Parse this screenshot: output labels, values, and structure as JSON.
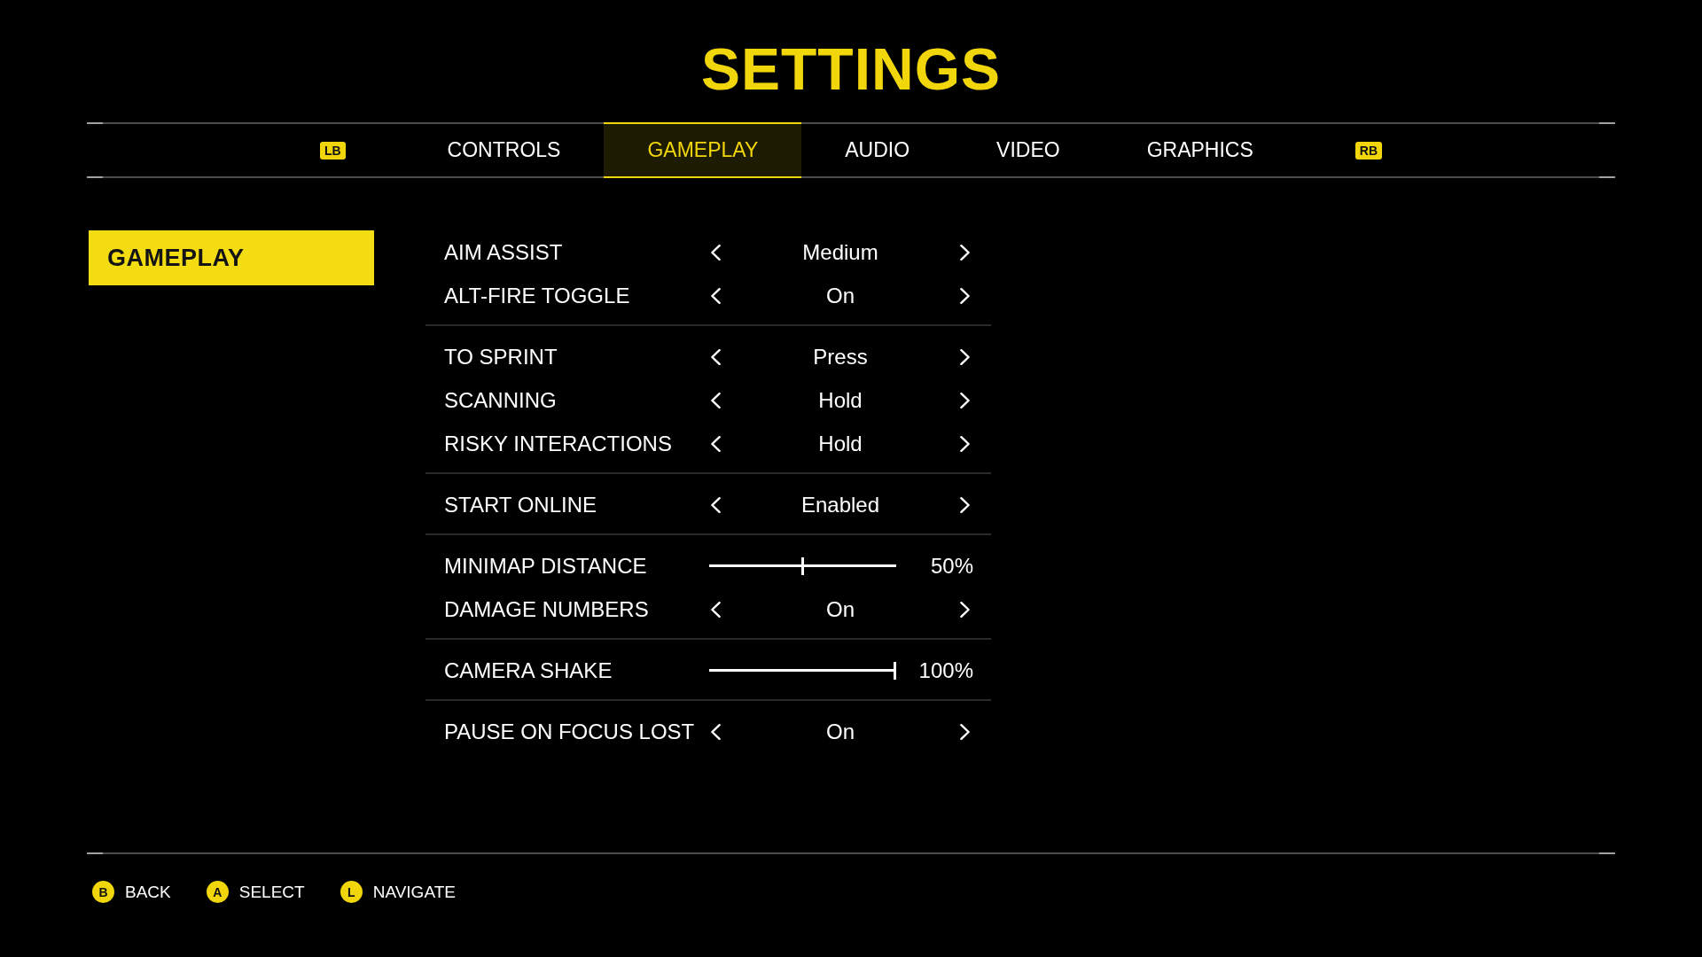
{
  "title": "SETTINGS",
  "tab_bar": {
    "prev_key": "LB",
    "next_key": "RB",
    "tabs": [
      {
        "label": "CONTROLS",
        "selected": false
      },
      {
        "label": "GAMEPLAY",
        "selected": true
      },
      {
        "label": "AUDIO",
        "selected": false
      },
      {
        "label": "VIDEO",
        "selected": false
      },
      {
        "label": "GRAPHICS",
        "selected": false
      }
    ]
  },
  "sidebar": {
    "items": [
      {
        "label": "GAMEPLAY",
        "selected": true
      }
    ]
  },
  "settings": {
    "groups": [
      {
        "rows": [
          {
            "kind": "selector",
            "label": "AIM ASSIST",
            "value": "Medium"
          },
          {
            "kind": "selector",
            "label": "ALT-FIRE TOGGLE",
            "value": "On"
          }
        ]
      },
      {
        "rows": [
          {
            "kind": "selector",
            "label": "TO SPRINT",
            "value": "Press"
          },
          {
            "kind": "selector",
            "label": "SCANNING",
            "value": "Hold"
          },
          {
            "kind": "selector",
            "label": "RISKY INTERACTIONS",
            "value": "Hold"
          }
        ]
      },
      {
        "rows": [
          {
            "kind": "selector",
            "label": "START ONLINE",
            "value": "Enabled"
          }
        ]
      },
      {
        "rows": [
          {
            "kind": "slider",
            "label": "MINIMAP DISTANCE",
            "level": 0.5,
            "reading": "50%"
          },
          {
            "kind": "selector",
            "label": "DAMAGE NUMBERS",
            "value": "On"
          }
        ]
      },
      {
        "rows": [
          {
            "kind": "slider",
            "label": "CAMERA SHAKE",
            "level": 1,
            "reading": "100%"
          }
        ]
      },
      {
        "rows": [
          {
            "kind": "selector",
            "label": "PAUSE ON FOCUS LOST",
            "value": "On"
          }
        ]
      }
    ]
  },
  "footer": {
    "hints": [
      {
        "key": "B",
        "label": "BACK"
      },
      {
        "key": "A",
        "label": "SELECT"
      },
      {
        "key": "L",
        "label": "NAVIGATE"
      }
    ]
  }
}
